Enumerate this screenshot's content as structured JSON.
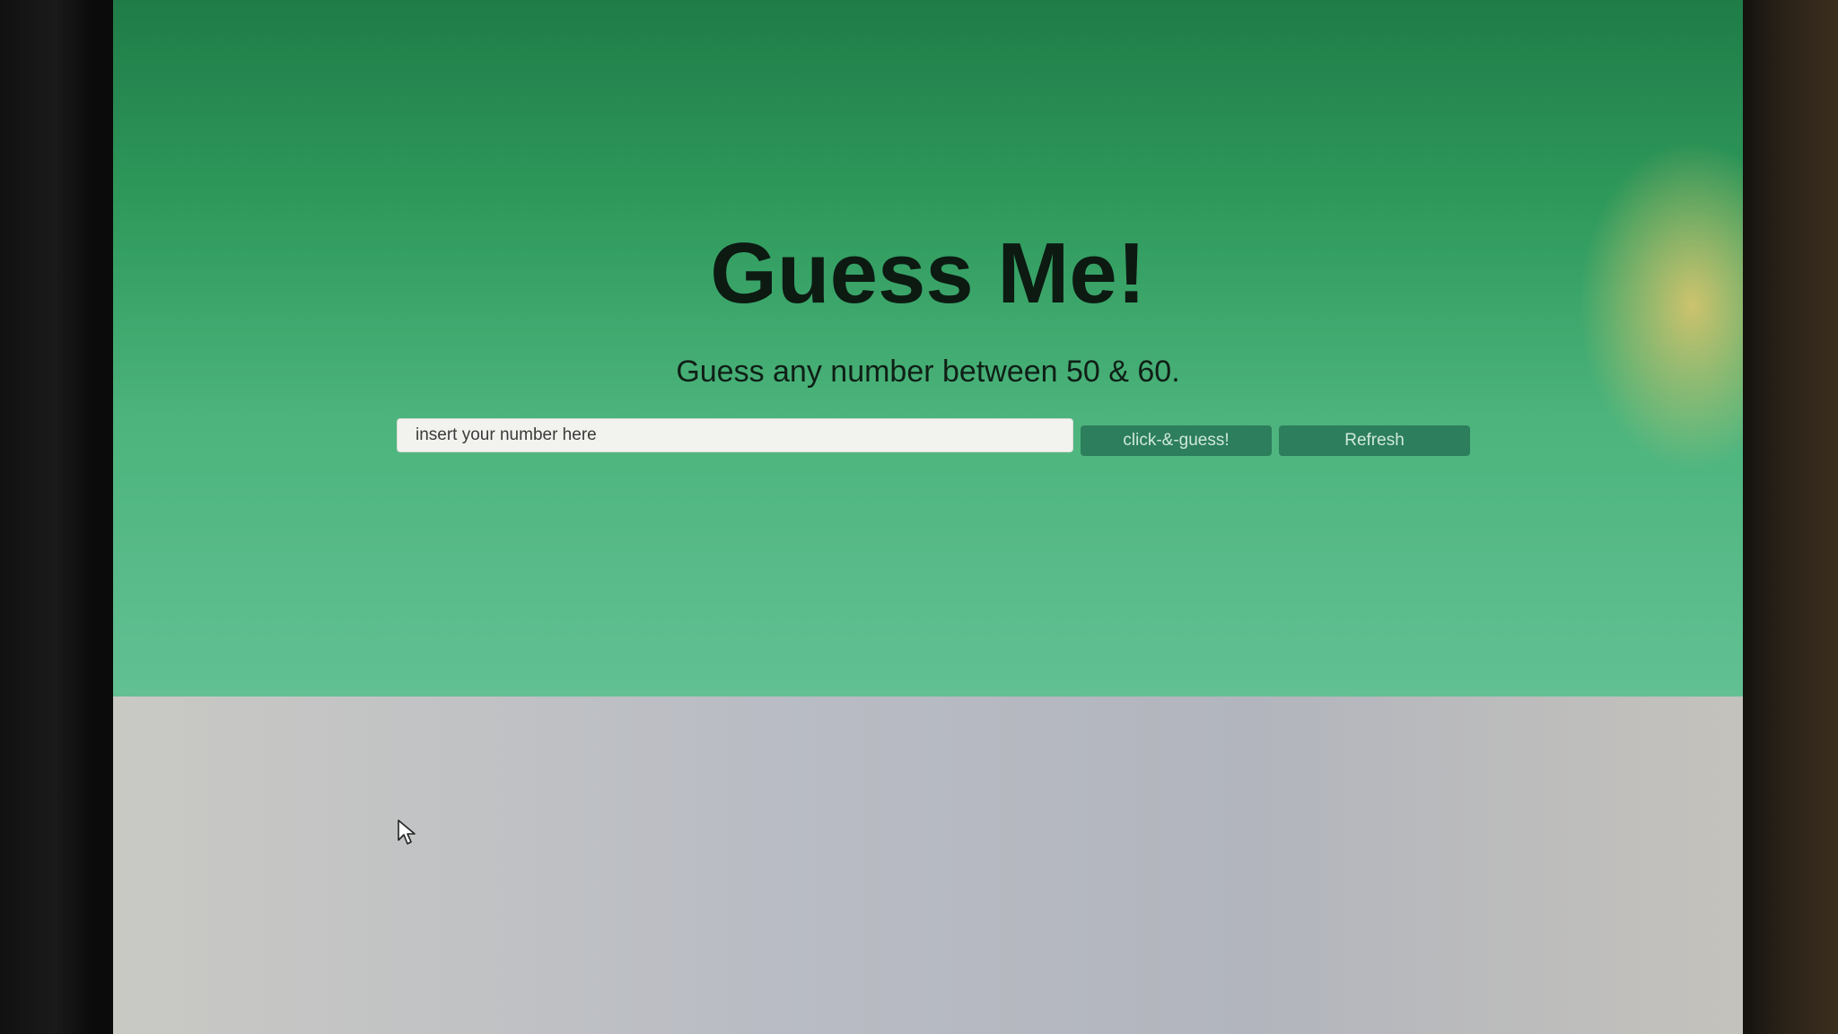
{
  "page": {
    "title": "Guess Me!",
    "subtitle": "Guess any number between 50 & 60."
  },
  "form": {
    "input_placeholder": "insert your number here",
    "input_value": "",
    "guess_button_label": "click-&-guess!",
    "refresh_button_label": "Refresh"
  },
  "colors": {
    "hero_background": "#3fa870",
    "button_background": "#2d7e5c",
    "lower_background": "#b9bcc4"
  },
  "icons": {
    "cursor": "mouse-pointer-icon"
  }
}
